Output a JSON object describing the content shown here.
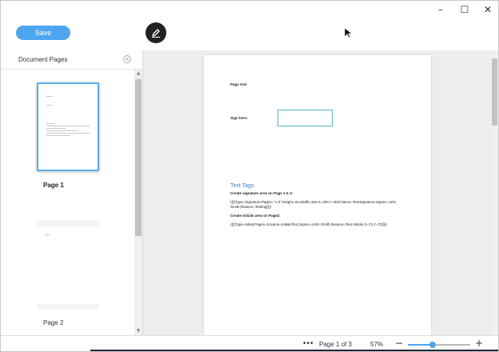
{
  "window_controls": {
    "minimize": "–",
    "maximize": "☐",
    "close": "✕"
  },
  "toolbar": {
    "save_label": "Save"
  },
  "sidebar": {
    "title": "Document Pages",
    "close_glyph": "×",
    "pages": [
      {
        "label": "Page 1",
        "selected": true
      },
      {
        "label": "Page 2",
        "selected": false
      }
    ]
  },
  "document": {
    "page_one": "Page One",
    "sign_here": "Sign here:",
    "text_tags_heading": "Text Tags",
    "line1": "Create signature area on Page 1 & 3:",
    "line2a": "{{{{Type=Signature,Pages=\"1,3\",Height=44,Width=150,X=200,Y=600,Name=TextSignature,Signer=John",
    "line2b": "Smith,Reason=Testing}}}}",
    "line3": "Create Initials area on Page2:",
    "line4": "{{{{Type=Initial,Pages=2,Name=InitialsText,Signer=John Smith,Reason=Test Initials,X=72,Y=72}}}}"
  },
  "statusbar": {
    "more": "•••",
    "page_indicator": "Page 1 of 3",
    "zoom": "57%",
    "zoom_minus": "−",
    "zoom_plus": "+",
    "zoom_level": 0.4
  },
  "colors": {
    "accent": "#4da6ef",
    "selection": "#5aaee8",
    "tag_heading": "#3a7fc4"
  }
}
